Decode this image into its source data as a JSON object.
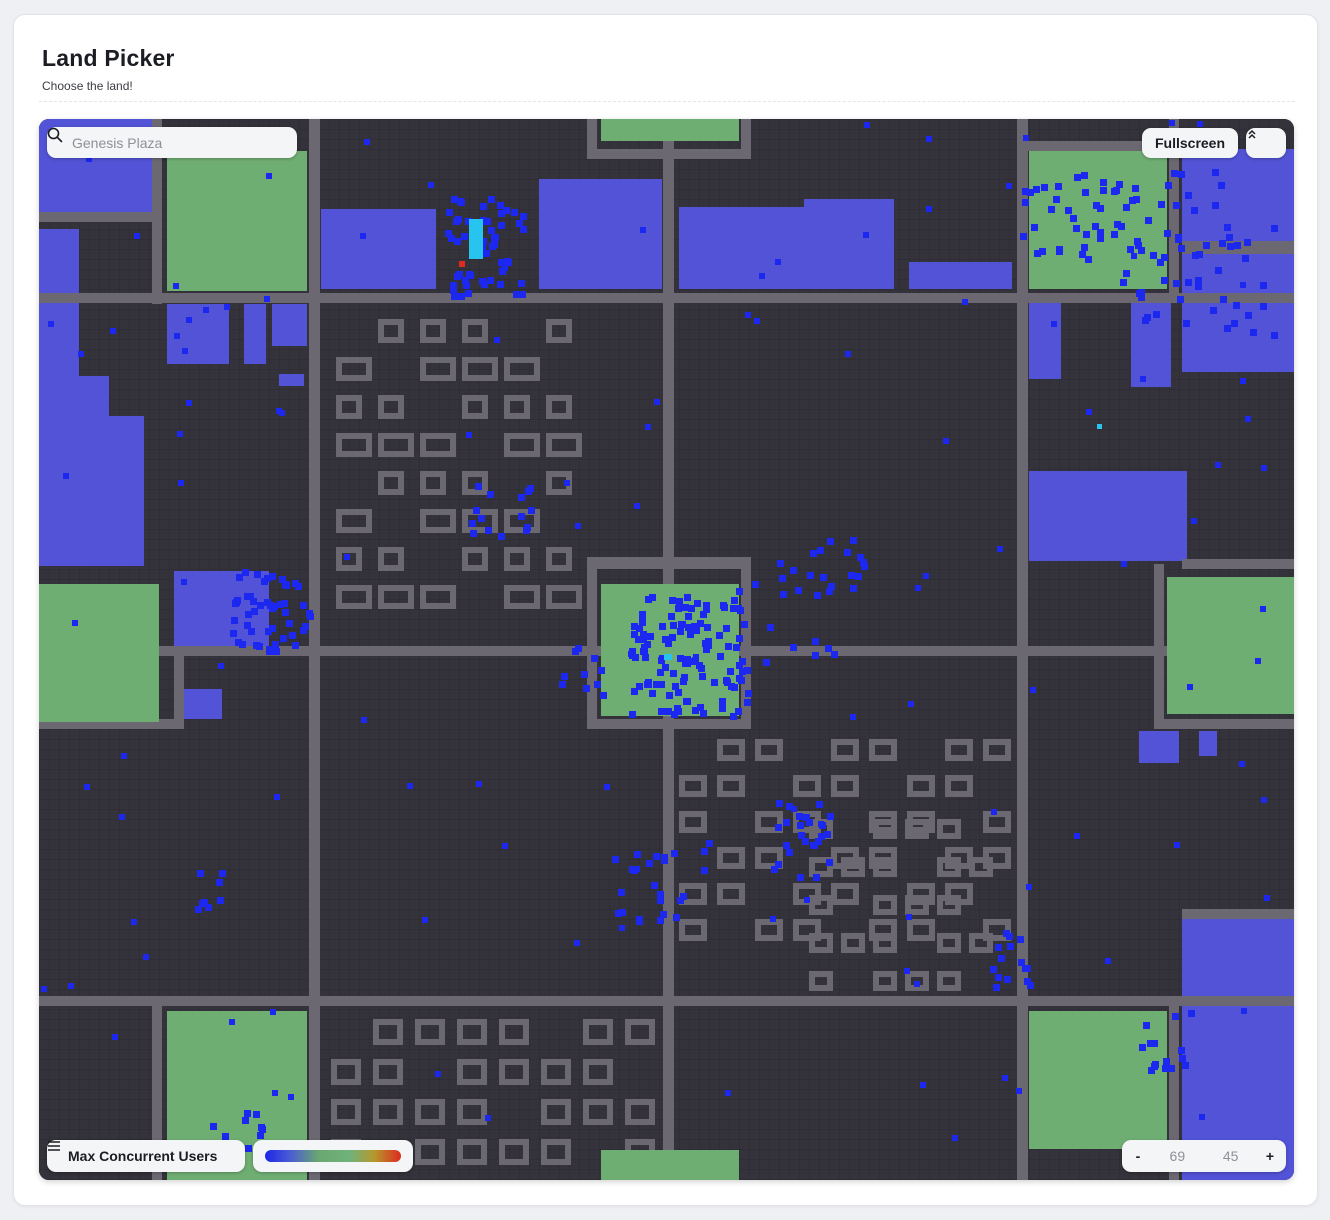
{
  "header": {
    "title": "Land Picker",
    "subtitle": "Choose the land!"
  },
  "search": {
    "placeholder": "Genesis Plaza",
    "icon": "search-icon"
  },
  "controls": {
    "fullscreen_label": "Fullscreen",
    "collapse_icon": "chevrons-up-icon",
    "layer_label": "Max Concurrent Users",
    "layer_icon": "menu-icon",
    "zoom_out": "-",
    "zoom_in": "+",
    "coord_x": "69",
    "coord_y": "45"
  },
  "legend": {
    "gradient": [
      "#1c27e6",
      "#4a5bd6",
      "#6aa86f",
      "#b49a2e",
      "#e02a1d"
    ]
  },
  "colors": {
    "road": "#6b6871",
    "parcel": "#34323a",
    "plaza": "#6fae73",
    "district": "#5253d6",
    "activity_low": "#1c27f0",
    "activity_mid": "#27c4f0",
    "activity_high": "#e02a1d"
  }
}
